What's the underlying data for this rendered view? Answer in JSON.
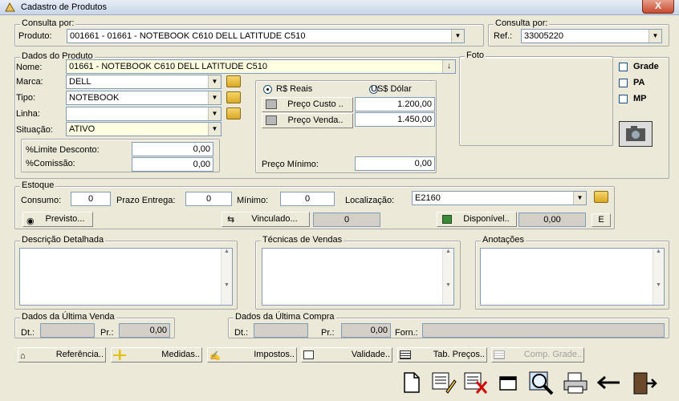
{
  "window": {
    "title": "Cadastro de Produtos",
    "close": "X"
  },
  "consulta": {
    "group_label": "Consulta por:",
    "produto_label": "Produto:",
    "produto_value": "001661 - 01661 - NOTEBOOK  C610     DELL  LATITUDE C510",
    "ref_group_label": "Consulta por:",
    "ref_label": "Ref.:",
    "ref_value": "33005220"
  },
  "dados": {
    "group_label": "Dados do Produto",
    "nome_label": "Nome:",
    "nome_value": "01661 - NOTEBOOK  C610     DELL  LATITUDE C510",
    "marca_label": "Marca:",
    "marca_value": "DELL",
    "tipo_label": "Tipo:",
    "tipo_value": "NOTEBOOK",
    "linha_label": "Linha:",
    "linha_value": "",
    "situacao_label": "Situação:",
    "situacao_value": "ATIVO",
    "limite_label": "%Limite Desconto:",
    "limite_value": "0,00",
    "comissao_label": "%Comissão:",
    "comissao_value": "0,00",
    "reais_label": "R$ Reais",
    "dolar_label": "US$ Dólar",
    "custo_label": "Preço Custo ..",
    "custo_value": "1.200,00",
    "venda_label": "Preço Venda..",
    "venda_value": "1.450,00",
    "minimo_label": "Preço Mínimo:",
    "minimo_value": "0,00"
  },
  "foto": {
    "group_label": "Foto",
    "grade_label": "Grade",
    "pa_label": "PA",
    "mp_label": "MP"
  },
  "estoque": {
    "group_label": "Estoque",
    "consumo_label": "Consumo:",
    "consumo_value": "0",
    "prazo_label": "Prazo Entrega:",
    "prazo_value": "0",
    "minimo_label": "Mínimo:",
    "minimo_value": "0",
    "localizacao_label": "Localização:",
    "localizacao_value": "E2160",
    "previsto_label": "Previsto...",
    "vinculado_label": "Vinculado...",
    "vinculado_value": "0",
    "disponivel_label": "Disponível..",
    "disponivel_value": "0,00",
    "e_label": "E"
  },
  "memos": {
    "descricao_label": "Descrição Detalhada",
    "tecnicas_label": "Técnicas de Vendas",
    "anotacoes_label": "Anotações"
  },
  "ultima_venda": {
    "group_label": "Dados da Última Venda",
    "dt_label": "Dt.:",
    "dt_value": "",
    "pr_label": "Pr.:",
    "pr_value": "0,00"
  },
  "ultima_compra": {
    "group_label": "Dados da Última Compra",
    "dt_label": "Dt.:",
    "dt_value": "",
    "pr_label": "Pr.:",
    "pr_value": "0,00",
    "forn_label": "Forn.:",
    "forn_value": ""
  },
  "bottom_buttons": {
    "referencia": "Referência..",
    "medidas": "Medidas..",
    "impostos": "Impostos..",
    "validade": "Validade..",
    "tab_precos": "Tab. Preços..",
    "comp_grade": "Comp. Grade.."
  }
}
